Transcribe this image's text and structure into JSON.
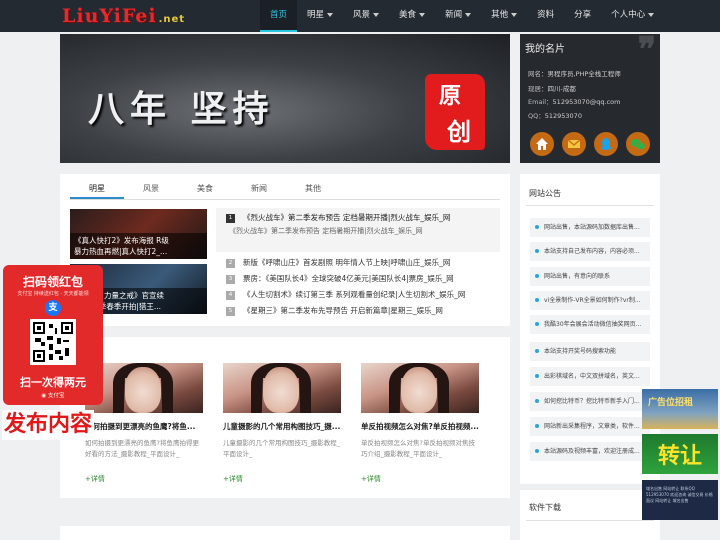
{
  "header": {
    "logo_main": "LiuYiFei",
    "logo_suffix": ".net",
    "nav": [
      {
        "label": "首页",
        "active": true,
        "dropdown": false
      },
      {
        "label": "明星",
        "active": false,
        "dropdown": true
      },
      {
        "label": "风景",
        "active": false,
        "dropdown": true
      },
      {
        "label": "美食",
        "active": false,
        "dropdown": true
      },
      {
        "label": "新闻",
        "active": false,
        "dropdown": true
      },
      {
        "label": "其他",
        "active": false,
        "dropdown": true
      },
      {
        "label": "资料",
        "active": false,
        "dropdown": false
      },
      {
        "label": "分享",
        "active": false,
        "dropdown": false
      },
      {
        "label": "个人中心",
        "active": false,
        "dropdown": true
      }
    ]
  },
  "banner": {
    "text": "八年 坚持",
    "seal_chars": [
      "原",
      "创"
    ],
    "slide_count": 5,
    "active_slide": 4
  },
  "profile": {
    "title": "我的名片",
    "rows": [
      {
        "key": "网名：",
        "value": "男程序员,PHP全栈工程师"
      },
      {
        "key": "现居：",
        "value": "四川-成都"
      },
      {
        "key": "Email：",
        "value": "512953070@qq.com"
      },
      {
        "key": "QQ：",
        "value": "512953070"
      }
    ],
    "icons": [
      "home-icon",
      "mail-icon",
      "qq-icon",
      "wechat-icon"
    ]
  },
  "news": {
    "tabs": [
      "明星",
      "风景",
      "美食",
      "新闻",
      "其他"
    ],
    "active_tab": 0,
    "thumbs": [
      {
        "caption": "《真人快打2》发布海报 R级",
        "caption2": "暴力热血再燃|真人快打2_..."
      },
      {
        "caption": "《猎王：力量之戒》官宣续",
        "caption2": "篇 第二季春季开拍|猎王..."
      }
    ],
    "headline": {
      "num": "1",
      "title": "《烈火战车》第二季发布预告 定档暑期开播|烈火战车_娱乐_网",
      "summary": "《烈火战车》第二季发布预告 定档暑期开播|烈火战车_娱乐_网"
    },
    "list": [
      {
        "num": "2",
        "text": "新版《呼啸山庄》首发剧照 明年情人节上映|呼啸山庄_娱乐_网"
      },
      {
        "num": "3",
        "text": "票房：《美国队长4》全球突破4亿美元|美国队长4|票房_娱乐_网"
      },
      {
        "num": "4",
        "text": "《人生切割术》续订第三季 系列观看量创纪录|人生切割术_娱乐_网"
      },
      {
        "num": "5",
        "text": "《星期三》第二季发布先导预告 开启新篇章|星期三_娱乐_网"
      }
    ]
  },
  "cards": [
    {
      "title": "如何拍摄到更漂亮的鱼鹰?将鱼...",
      "desc": "如何拍摄到更漂亮的鱼鹰?将鱼鹰拍得更好看的方法_摄影教程_平面设计_",
      "more": "+详情"
    },
    {
      "title": "儿童摄影的几个常用构图技巧_摄...",
      "desc": "儿童摄影的几个常用构图技巧_摄影教程_平面设计_",
      "more": "+详情"
    },
    {
      "title": "单反拍视频怎么对焦?单反拍视频...",
      "desc": "单反拍视频怎么对焦?单反拍视频对焦技巧介绍_摄影教程_平面设计_",
      "more": "+详情"
    }
  ],
  "notice": {
    "title": "网站公告",
    "items": [
      "网站出售，本站源码加数据库出售...",
      "本站支持自己发布内容，内容必须...",
      "网站出售，有意向的联系",
      "vi全景制作-VR全景如何制作?vr制...",
      "我酷30年会展会活动微信抽奖网页...",
      "本站支持开奖号码搜索功能",
      "出彩棋域名，中文双拼域名，英文...",
      "如何挖比特币？挖比特币新手入门...",
      "网站新出采集程序，文章类，软件...",
      "本站源码及视频丰富，欢迎注册成..."
    ]
  },
  "soft": {
    "title": "软件下载"
  },
  "ads": {
    "left_header": "扫码领红包",
    "left_sub": "支付宝 持续送红包 · 天天都能领",
    "left_alipay": "支",
    "left_scan": "扫一次得两元",
    "left_brand": "◉ 支付宝",
    "publish": "发布内容",
    "right1": "广告位招租",
    "right2": "转让",
    "right3": "域名出售 网站转让 联系QQ 512953070 欢迎咨询 诚信交易 价格面议 网站转让 域名出售"
  },
  "colors": {
    "header_bg": "#232a31",
    "accent": "#2cc7e0",
    "logo_red": "#e8282a",
    "seal_red": "#e21c1c",
    "profile_bg": "#262a2f",
    "icon_orange": "#c46a14",
    "link_green": "#2a8a2a",
    "bullet_blue": "#2aa7d4"
  }
}
